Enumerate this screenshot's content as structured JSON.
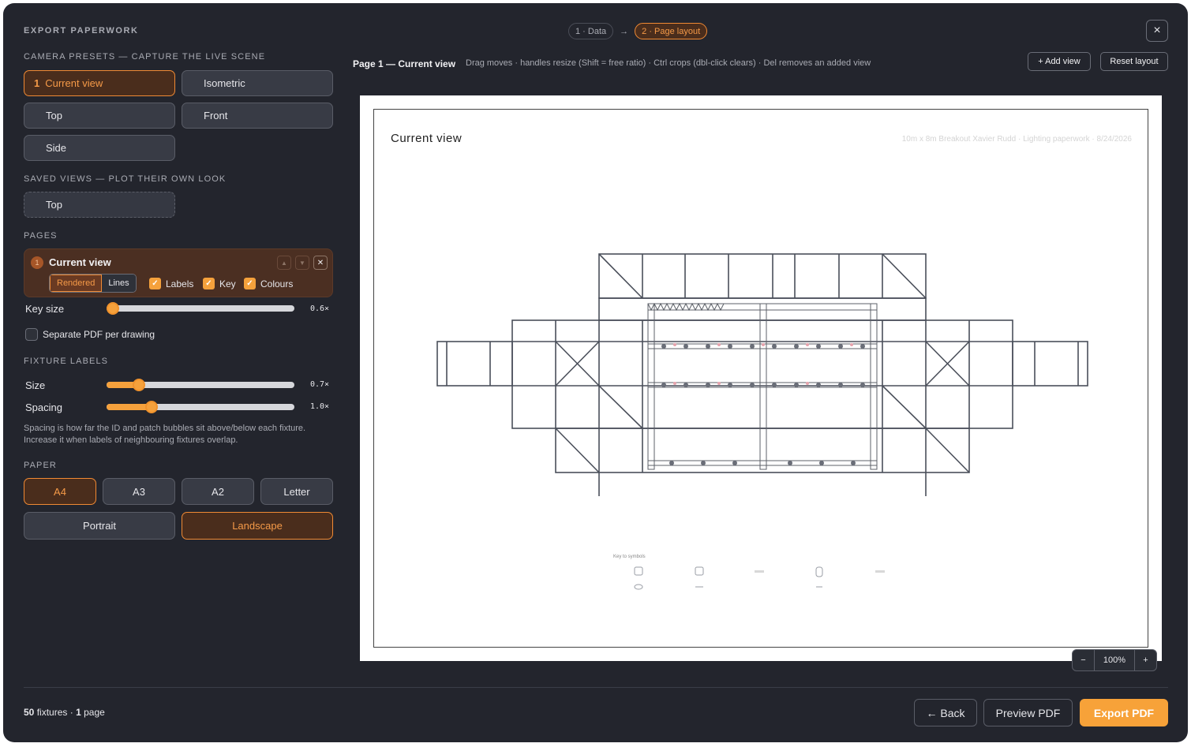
{
  "header": {
    "title": "EXPORT PAPERWORK",
    "steps": [
      "1 · Data",
      "2 · Page layout"
    ],
    "step_arrow": "→",
    "close_icon": "×"
  },
  "sidebar": {
    "camera_presets_label": "CAMERA PRESETS — CAPTURE THE LIVE SCENE",
    "presets": [
      {
        "num": "1",
        "label": "Current view",
        "selected": true
      },
      {
        "label": "Isometric"
      },
      {
        "label": "Top"
      },
      {
        "label": "Front"
      },
      {
        "label": "Side"
      }
    ],
    "saved_views_label": "SAVED VIEWS — PLOT THEIR OWN LOOK",
    "saved_views": [
      "Top"
    ],
    "pages_label": "PAGES",
    "page": {
      "num": "1",
      "name": "Current view",
      "render_modes": [
        "Rendered",
        "Lines"
      ],
      "render_selected": "Rendered",
      "options": [
        {
          "label": "Labels",
          "checked": true
        },
        {
          "label": "Key",
          "checked": true
        },
        {
          "label": "Colours",
          "checked": true
        }
      ]
    },
    "key_size": {
      "label": "Key size",
      "value_text": "0.6×",
      "fraction": 0.0
    },
    "separate_pdf": {
      "label": "Separate PDF per drawing",
      "checked": false
    },
    "fixture_labels_label": "FIXTURE LABELS",
    "size": {
      "label": "Size",
      "value_text": "0.7×",
      "fraction": 0.15
    },
    "spacing": {
      "label": "Spacing",
      "value_text": "1.0×",
      "fraction": 0.22
    },
    "help_text": "Spacing is how far the ID and patch bubbles sit above/below each fixture. Increase it when labels of neighbouring fixtures overlap.",
    "paper_label": "PAPER",
    "paper_sizes": [
      "A4",
      "A3",
      "A2",
      "Letter"
    ],
    "paper_selected": "A4",
    "orientations": [
      "Portrait",
      "Landscape"
    ],
    "orientation_selected": "Landscape"
  },
  "main": {
    "page_heading": "Page 1 — Current view",
    "hint": "Drag moves · handles resize (Shift = free ratio) · Ctrl crops (dbl-click clears) · Del removes an added view",
    "add_view": "+ Add view",
    "reset_layout": "Reset layout",
    "paper_title": "Current view",
    "paper_meta": "10m x 8m Breakout Xavier Rudd · Lighting paperwork · 8/24/2026",
    "key_title": "Key to symbols",
    "zoom": {
      "minus": "−",
      "level": "100%",
      "plus": "+"
    }
  },
  "footer": {
    "fixture_count": "50",
    "fixtures_word": "fixtures ·",
    "page_count": "1",
    "page_word": "page",
    "back": "← Back",
    "preview": "Preview PDF",
    "export": "Export PDF"
  },
  "colors": {
    "accent": "#f5a13c",
    "background": "#23252d",
    "selected_fill": "#4a2d1c"
  }
}
